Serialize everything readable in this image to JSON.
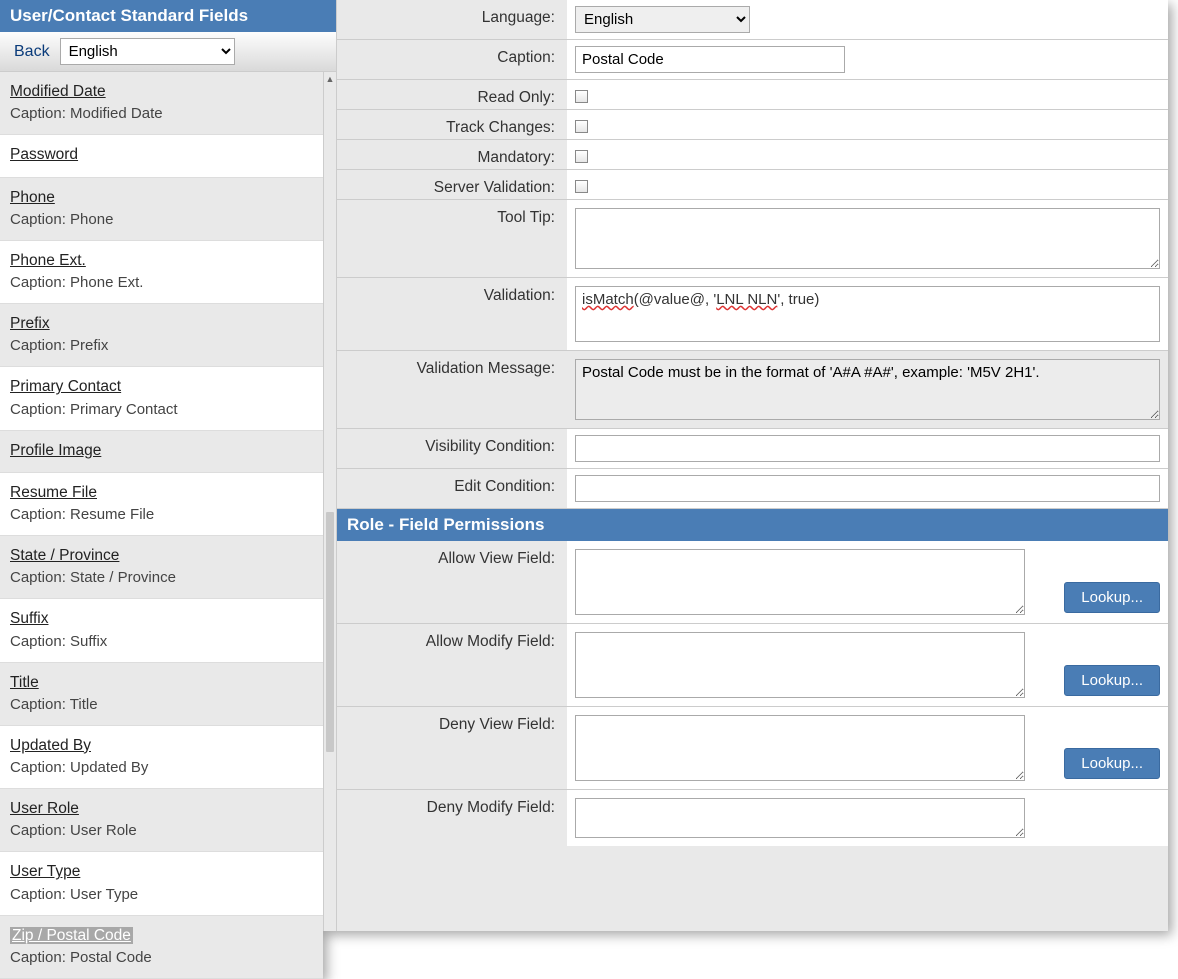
{
  "sidebar": {
    "title": "User/Contact Standard Fields",
    "back_label": "Back",
    "language_value": "English",
    "items": [
      {
        "name": "Modified Date",
        "caption": "Caption: Modified Date",
        "selected": false
      },
      {
        "name": "Password",
        "caption": "",
        "selected": false
      },
      {
        "name": "Phone",
        "caption": "Caption: Phone",
        "selected": false
      },
      {
        "name": "Phone Ext.",
        "caption": "Caption: Phone Ext.",
        "selected": false
      },
      {
        "name": "Prefix",
        "caption": "Caption: Prefix",
        "selected": false
      },
      {
        "name": "Primary Contact",
        "caption": "Caption: Primary Contact",
        "selected": false
      },
      {
        "name": "Profile Image",
        "caption": "",
        "selected": false
      },
      {
        "name": "Resume File",
        "caption": "Caption: Resume File",
        "selected": false
      },
      {
        "name": "State / Province",
        "caption": "Caption: State / Province",
        "selected": false
      },
      {
        "name": "Suffix",
        "caption": "Caption: Suffix",
        "selected": false
      },
      {
        "name": "Title",
        "caption": "Caption: Title",
        "selected": false
      },
      {
        "name": "Updated By",
        "caption": "Caption: Updated By",
        "selected": false
      },
      {
        "name": "User Role",
        "caption": "Caption: User Role",
        "selected": false
      },
      {
        "name": "User Type",
        "caption": "Caption: User Type",
        "selected": false
      },
      {
        "name": "Zip / Postal Code",
        "caption": "Caption: Postal Code",
        "selected": true
      }
    ]
  },
  "form": {
    "labels": {
      "language": "Language:",
      "caption": "Caption:",
      "read_only": "Read Only:",
      "track_changes": "Track Changes:",
      "mandatory": "Mandatory:",
      "server_validation": "Server Validation:",
      "tool_tip": "Tool Tip:",
      "validation": "Validation:",
      "validation_message": "Validation Message:",
      "visibility_condition": "Visibility Condition:",
      "edit_condition": "Edit Condition:"
    },
    "values": {
      "language": "English",
      "caption": "Postal Code",
      "read_only": false,
      "track_changes": false,
      "mandatory": false,
      "server_validation": false,
      "tool_tip": "",
      "validation_prefix": "isMatch",
      "validation_mid": "(@value@, '",
      "validation_arg": "LNL NLN",
      "validation_suffix": "', true)",
      "validation_message": "Postal Code must be in the format of 'A#A #A#', example: 'M5V 2H1'.",
      "visibility_condition": "",
      "edit_condition": ""
    }
  },
  "permissions": {
    "header": "Role - Field Permissions",
    "labels": {
      "allow_view": "Allow View Field:",
      "allow_modify": "Allow Modify Field:",
      "deny_view": "Deny View Field:",
      "deny_modify": "Deny Modify Field:"
    },
    "lookup_label": "Lookup...",
    "values": {
      "allow_view": "",
      "allow_modify": "",
      "deny_view": "",
      "deny_modify": ""
    }
  }
}
